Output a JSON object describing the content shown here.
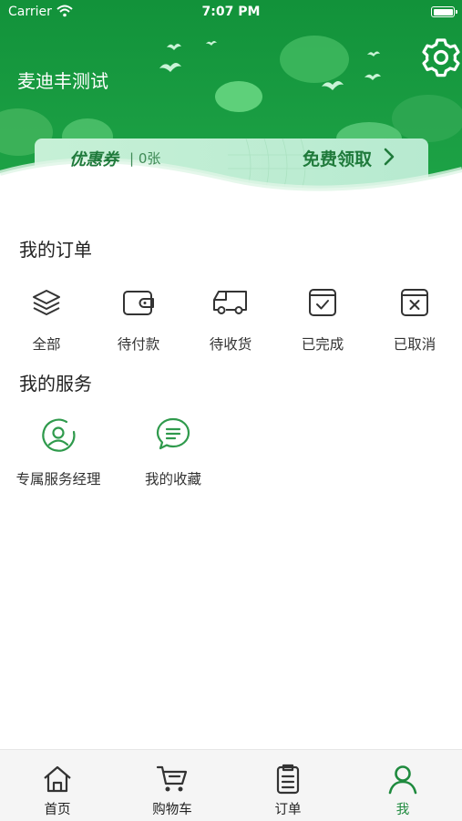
{
  "status_bar": {
    "carrier": "Carrier",
    "time": "7:07 PM"
  },
  "header": {
    "user_name": "麦迪丰测试"
  },
  "coupon": {
    "title": "优惠券",
    "count": "| 0张",
    "claim_label": "免费领取"
  },
  "orders": {
    "title": "我的订单",
    "items": [
      {
        "label": "全部",
        "icon": "layers-icon"
      },
      {
        "label": "待付款",
        "icon": "wallet-icon"
      },
      {
        "label": "待收货",
        "icon": "truck-icon"
      },
      {
        "label": "已完成",
        "icon": "check-box-icon"
      },
      {
        "label": "已取消",
        "icon": "x-box-icon"
      }
    ]
  },
  "services": {
    "title": "我的服务",
    "items": [
      {
        "label": "专属服务经理",
        "icon": "service-manager-icon"
      },
      {
        "label": "我的收藏",
        "icon": "chat-bubble-icon"
      }
    ]
  },
  "tab_bar": {
    "tabs": [
      {
        "label": "首页",
        "icon": "home-icon",
        "active": false
      },
      {
        "label": "购物车",
        "icon": "cart-icon",
        "active": false
      },
      {
        "label": "订单",
        "icon": "clipboard-icon",
        "active": false
      },
      {
        "label": "我",
        "icon": "person-icon",
        "active": true
      }
    ]
  },
  "colors": {
    "brand_green": "#1f8a3e",
    "header_green": "#179a3d",
    "coupon_bg": "#c9f2d8"
  }
}
